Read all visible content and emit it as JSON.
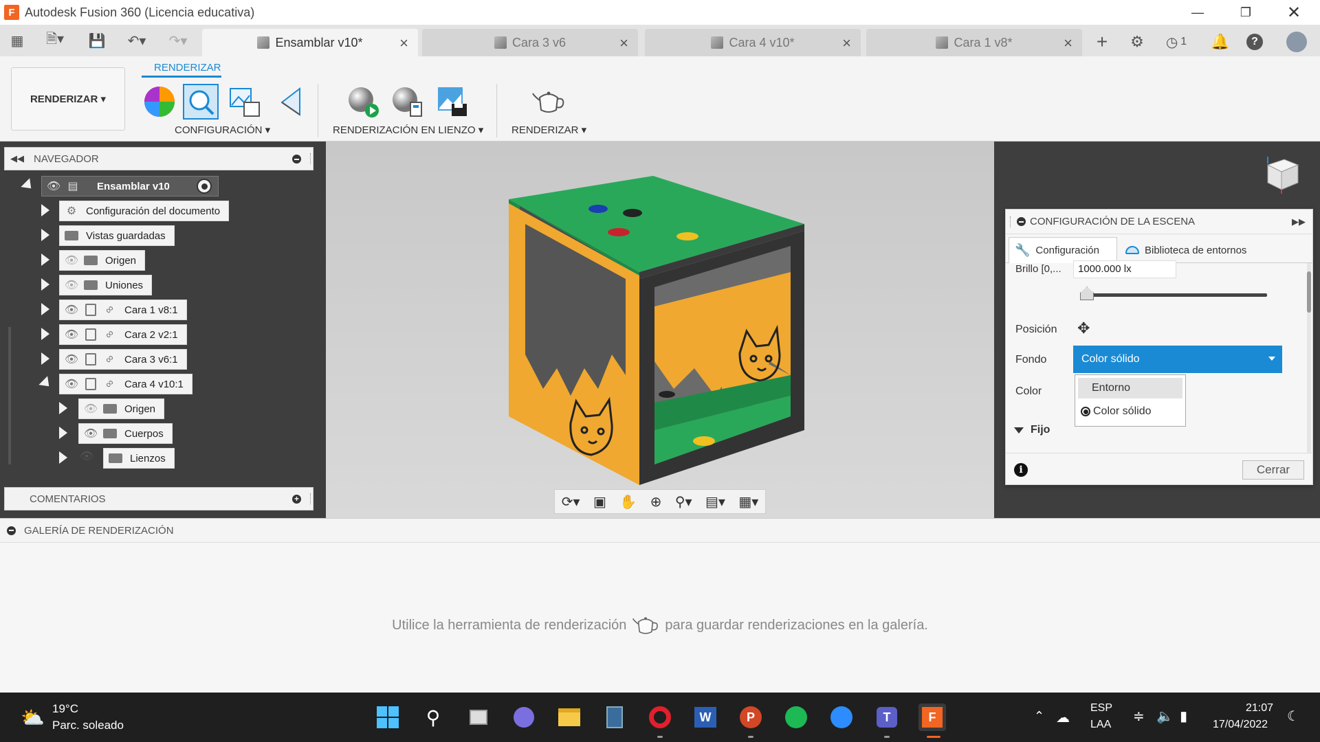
{
  "window": {
    "title": "Autodesk Fusion 360 (Licencia educativa)",
    "app_icon_letter": "F"
  },
  "tabs": [
    {
      "label": "Ensamblar v10*",
      "active": true
    },
    {
      "label": "Cara 3 v6",
      "active": false
    },
    {
      "label": "Cara 4 v10*",
      "active": false
    },
    {
      "label": "Cara 1 v8*",
      "active": false
    }
  ],
  "job_status_count": "1",
  "ribbon": {
    "workspace": "RENDERIZAR",
    "active_tab": "RENDERIZAR",
    "groups": {
      "config": "CONFIGURACIÓN",
      "in_canvas": "RENDERIZACIÓN EN LIENZO",
      "render": "RENDERIZAR"
    }
  },
  "browser": {
    "title": "NAVEGADOR",
    "root": "Ensamblar v10",
    "items": [
      {
        "label": "Configuración del documento"
      },
      {
        "label": "Vistas guardadas"
      },
      {
        "label": "Origen"
      },
      {
        "label": "Uniones"
      },
      {
        "label": "Cara 1 v8:1"
      },
      {
        "label": "Cara 2 v2:1"
      },
      {
        "label": "Cara 3 v6:1"
      },
      {
        "label": "Cara 4 v10:1"
      },
      {
        "label": "Origen"
      },
      {
        "label": "Cuerpos"
      },
      {
        "label": "Lienzos"
      }
    ],
    "comments": "COMENTARIOS"
  },
  "scene_panel": {
    "title": "CONFIGURACIÓN DE LA ESCENA",
    "tabs": [
      "Configuración",
      "Biblioteca de entornos"
    ],
    "brightness_label": "Brillo [0,...",
    "brightness_value": "1000.000 lx",
    "position_label": "Posición",
    "background_label": "Fondo",
    "background_value": "Color sólido",
    "color_label": "Color",
    "dropdown_options": [
      "Entorno",
      "Color sólido"
    ],
    "fixed_label": "Fijo",
    "close_label": "Cerrar"
  },
  "gallery": {
    "title": "GALERÍA DE RENDERIZACIÓN",
    "hint_before": "Utilice la herramienta de renderización",
    "hint_after": "para guardar renderizaciones en la galería."
  },
  "taskbar": {
    "weather_temp": "19°C",
    "weather_desc": "Parc. soleado",
    "lang_top": "ESP",
    "lang_bottom": "LAA",
    "time": "21:07",
    "date": "17/04/2022"
  },
  "colors": {
    "accent": "#1a8ad4",
    "dark_panel": "#3e3e3e",
    "box_green": "#2aa85a",
    "box_orange": "#f0a830",
    "frame": "#3a3a3a"
  }
}
